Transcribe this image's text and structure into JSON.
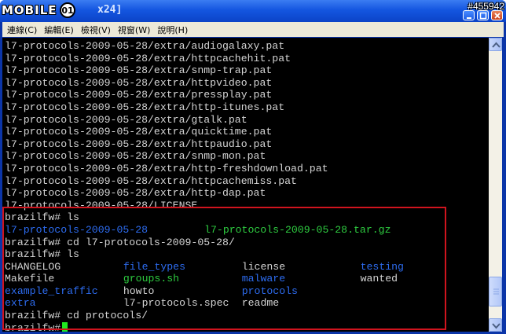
{
  "window": {
    "title_fragment": "x24]",
    "logo_text": "MOBILE",
    "watermark_tag": "#455942"
  },
  "menu": {
    "items": [
      "連線(C)",
      "編輯(E)",
      "檢視(V)",
      "視窗(W)",
      "說明(H)"
    ]
  },
  "terminal": {
    "lines": [
      [
        {
          "text": "l7-protocols-2009-05-28/extra/audiogalaxy.pat",
          "color": "white",
          "col": 0
        }
      ],
      [
        {
          "text": "l7-protocols-2009-05-28/extra/httpcachehit.pat",
          "color": "white",
          "col": 0
        }
      ],
      [
        {
          "text": "l7-protocols-2009-05-28/extra/snmp-trap.pat",
          "color": "white",
          "col": 0
        }
      ],
      [
        {
          "text": "l7-protocols-2009-05-28/extra/httpvideo.pat",
          "color": "white",
          "col": 0
        }
      ],
      [
        {
          "text": "l7-protocols-2009-05-28/extra/pressplay.pat",
          "color": "white",
          "col": 0
        }
      ],
      [
        {
          "text": "l7-protocols-2009-05-28/extra/http-itunes.pat",
          "color": "white",
          "col": 0
        }
      ],
      [
        {
          "text": "l7-protocols-2009-05-28/extra/gtalk.pat",
          "color": "white",
          "col": 0
        }
      ],
      [
        {
          "text": "l7-protocols-2009-05-28/extra/quicktime.pat",
          "color": "white",
          "col": 0
        }
      ],
      [
        {
          "text": "l7-protocols-2009-05-28/extra/httpaudio.pat",
          "color": "white",
          "col": 0
        }
      ],
      [
        {
          "text": "l7-protocols-2009-05-28/extra/snmp-mon.pat",
          "color": "white",
          "col": 0
        }
      ],
      [
        {
          "text": "l7-protocols-2009-05-28/extra/http-freshdownload.pat",
          "color": "white",
          "col": 0
        }
      ],
      [
        {
          "text": "l7-protocols-2009-05-28/extra/httpcachemiss.pat",
          "color": "white",
          "col": 0
        }
      ],
      [
        {
          "text": "l7-protocols-2009-05-28/extra/http-dap.pat",
          "color": "white",
          "col": 0
        }
      ],
      [
        {
          "text": "l7-protocols-2009-05-28/LICENSE",
          "color": "white",
          "col": 0
        }
      ],
      [
        {
          "text": "brazilfw# ls",
          "color": "white",
          "col": 0
        }
      ],
      [
        {
          "text": "l7-protocols-2009-05-28",
          "color": "blue",
          "col": 0
        },
        {
          "text": "l7-protocols-2009-05-28.tar.gz",
          "color": "green",
          "col": 32
        }
      ],
      [
        {
          "text": "brazilfw# cd l7-protocols-2009-05-28/",
          "color": "white",
          "col": 0
        }
      ],
      [
        {
          "text": "brazilfw# ls",
          "color": "white",
          "col": 0
        }
      ],
      [
        {
          "text": "CHANGELOG",
          "color": "white",
          "col": 0
        },
        {
          "text": "file_types",
          "color": "blue",
          "col": 19
        },
        {
          "text": "license",
          "color": "white",
          "col": 38
        },
        {
          "text": "testing",
          "color": "blue",
          "col": 57
        }
      ],
      [
        {
          "text": "Makefile",
          "color": "white",
          "col": 0
        },
        {
          "text": "groups.sh",
          "color": "green",
          "col": 19
        },
        {
          "text": "malware",
          "color": "blue",
          "col": 38
        },
        {
          "text": "wanted",
          "color": "white",
          "col": 57
        }
      ],
      [
        {
          "text": "example_traffic",
          "color": "blue",
          "col": 0
        },
        {
          "text": "howto",
          "color": "white",
          "col": 19
        },
        {
          "text": "protocols",
          "color": "blue",
          "col": 38
        }
      ],
      [
        {
          "text": "extra",
          "color": "blue",
          "col": 0
        },
        {
          "text": "l7-protocols.spec",
          "color": "white",
          "col": 19
        },
        {
          "text": "readme",
          "color": "white",
          "col": 38
        }
      ],
      [
        {
          "text": "brazilfw# cd protocols/",
          "color": "white",
          "col": 0
        }
      ]
    ],
    "prompt": "brazilfw#"
  },
  "colors": {
    "terminal_bg": "#000000",
    "text_white": "#d4d4d4",
    "text_blue": "#2d6cf0",
    "text_green": "#2ecc40",
    "cursor": "#1fe81f",
    "highlight": "#d0141e",
    "titlebar": "#1456e0"
  },
  "scrollbar": {
    "position_fraction": 0.95
  }
}
